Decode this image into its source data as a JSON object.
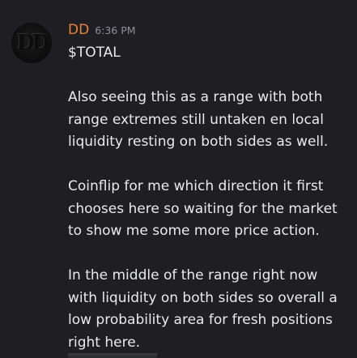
{
  "message": {
    "author": "DD",
    "avatar_initials": "DD",
    "timestamp": "6:36 PM",
    "author_color": "#e8833a",
    "paragraphs": [
      "$TOTAL",
      "Also seeing this as a range with both\nrange extremes still untaken en local\nliquidity resting on both sides as well.",
      "Coinflip for me which direction it first\nchooses here so waiting for the market\nto show me some more price action.",
      "In the middle of the range right now\nwith liquidity on both sides so overall a\nlow probability area for fresh positions\nright here."
    ]
  }
}
